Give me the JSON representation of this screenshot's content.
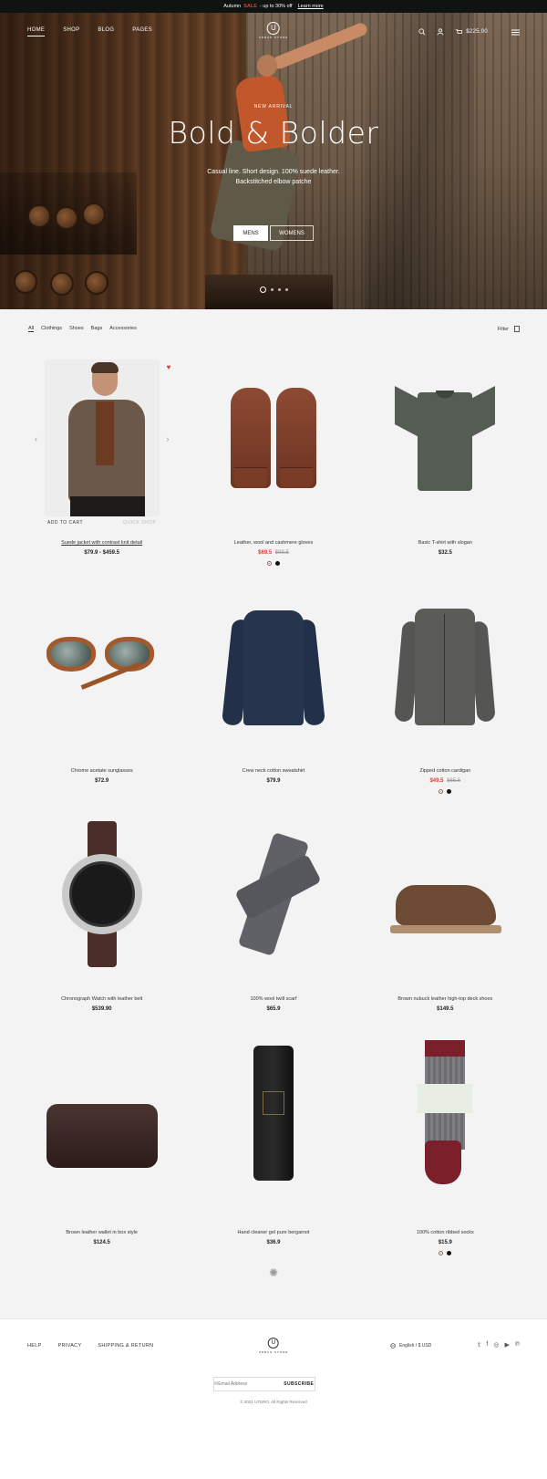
{
  "topbar": {
    "prefix": "Autumn",
    "sale": "SALE",
    "suffix": "- up to 30% off",
    "learn": "Learn more"
  },
  "nav": {
    "links": [
      "HOME",
      "SHOP",
      "BLOG",
      "PAGES"
    ],
    "active_link": "HOME",
    "logo_mark": "U",
    "logo_sub": "URBAN STORE",
    "cart_total": "$225.00",
    "icons": [
      "search-icon",
      "user-icon",
      "cart-icon",
      "menu-icon"
    ]
  },
  "hero": {
    "eyebrow": "NEW ARRIVAL",
    "title": "Bold & Bolder",
    "desc_line1": "Casual line. Short design. 100% suede leather.",
    "desc_line2": "Backstitched elbow patche",
    "btn_mens": "MENS",
    "btn_womens": "WOMENS",
    "slides_count": 4,
    "active_slide": 1
  },
  "filters": {
    "categories": [
      "All",
      "Clothings",
      "Shoes",
      "Bags",
      "Accessories"
    ],
    "active": "All",
    "filter_label": "Filter"
  },
  "products": [
    {
      "name": "Suede jacket with contrast knit detail",
      "price": "$79.9 - $459.5",
      "add": "ADD TO CART",
      "quick": "QUICK SHOP"
    },
    {
      "name": "Leather, wool and cashmere gloves",
      "sale_price": "$69.5",
      "old_price": "$99.5"
    },
    {
      "name": "Basic T-shirt with slogan",
      "price": "$32.5"
    },
    {
      "name": "Chrome acetate sunglasses",
      "price": "$72.9"
    },
    {
      "name": "Crew neck cotton sweatshirt",
      "price": "$79.9"
    },
    {
      "name": "Zipped cotton cardigan",
      "sale_price": "$49.5",
      "old_price": "$65.5"
    },
    {
      "name": "Chronograph Watch with leather belt",
      "price": "$539.90"
    },
    {
      "name": "100% wool twill scarf",
      "price": "$65.9"
    },
    {
      "name": "Brown nubuck leather high-top deck shoes",
      "price": "$149.5"
    },
    {
      "name": "Brown leather wallet in box style",
      "price": "$124.5"
    },
    {
      "name": "Hand cleaner gel pure bergamot",
      "price": "$36.9"
    },
    {
      "name": "100% cotton ribbed socks",
      "price": "$15.9"
    }
  ],
  "footer": {
    "links": [
      "HELP",
      "PRIVACY",
      "SHIPPING & RETURN"
    ],
    "logo_mark": "U",
    "logo_sub": "URBAN STORE",
    "locale": "English / $ USD",
    "social": [
      "twitter-icon",
      "facebook-icon",
      "instagram-icon",
      "youtube-icon",
      "pinterest-icon"
    ],
    "email_placeholder": "Email Address",
    "subscribe": "SUBSCRIBE",
    "copyright": "© 2021 UTERO. All Rights Reserved"
  },
  "colors": {
    "accent": "#e23b2e",
    "dark": "#0f1412",
    "page_bg": "#f3f3f3"
  }
}
